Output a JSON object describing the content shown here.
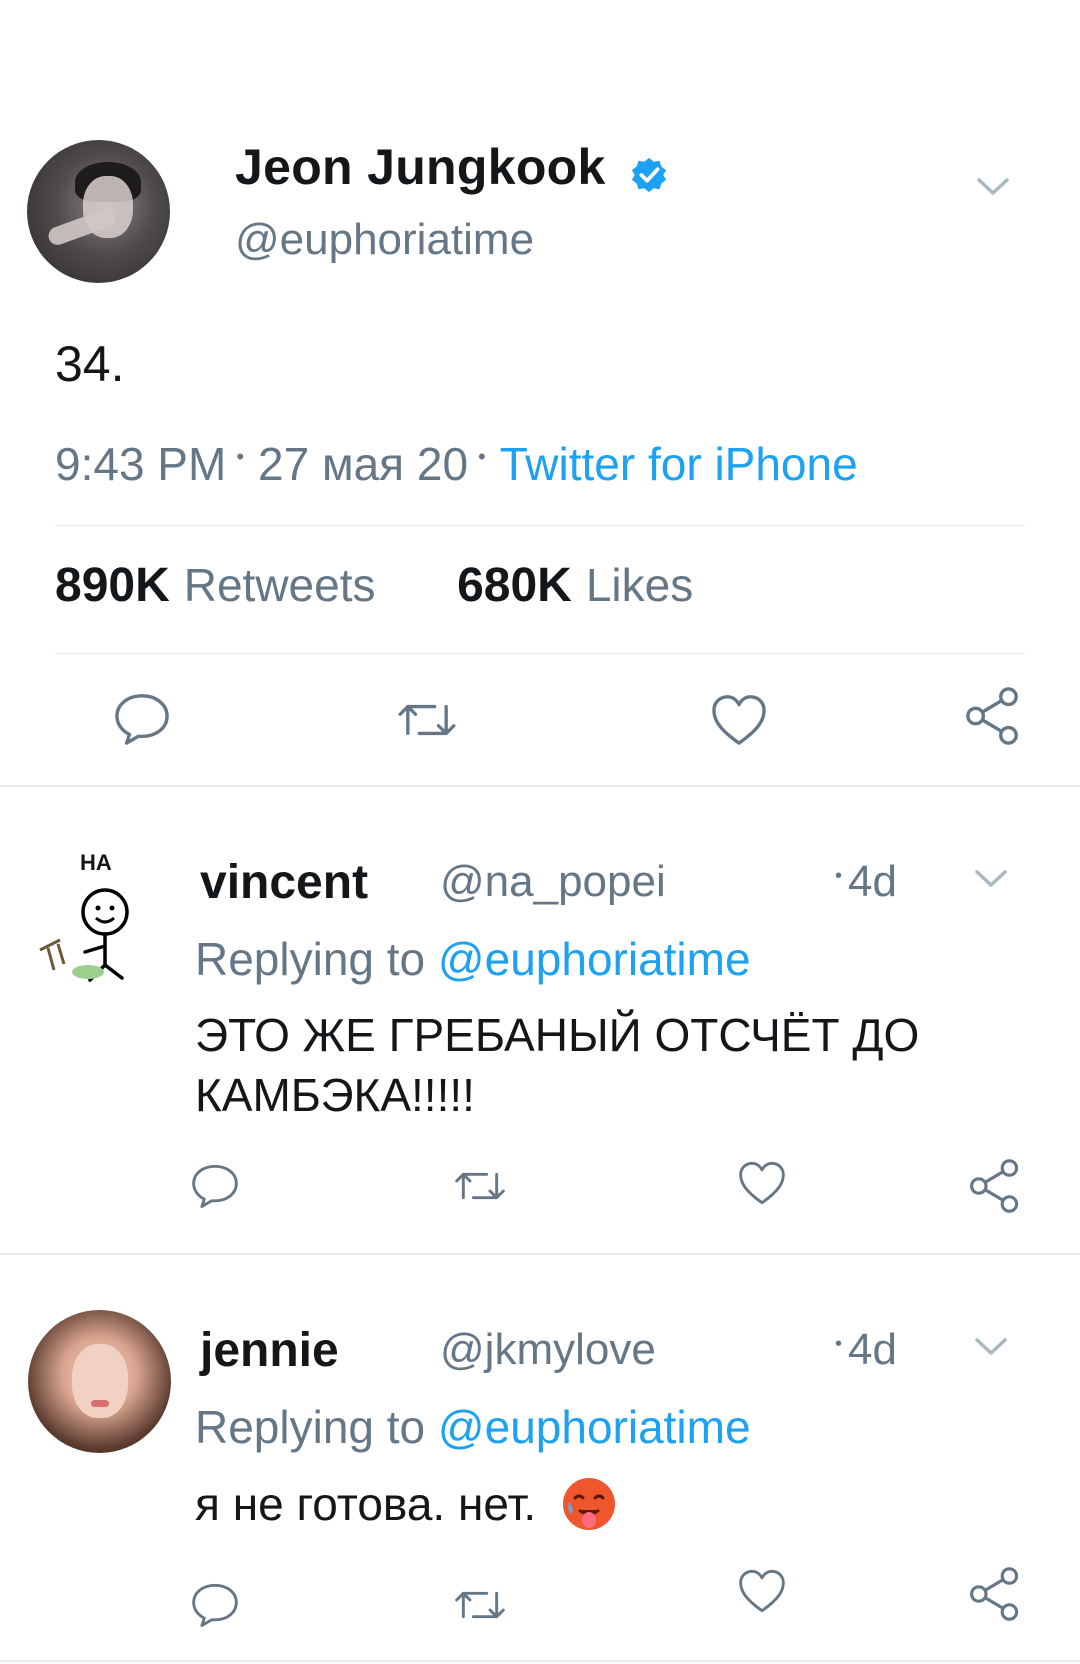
{
  "main_tweet": {
    "author_name": "Jeon Jungkook",
    "author_handle": "@euphoriatime",
    "text": "34.",
    "time": "9:43 PM",
    "date": "27 мая 20",
    "source": "Twitter for iPhone",
    "retweets_count": "890K",
    "retweets_label": "Retweets",
    "likes_count": "680K",
    "likes_label": "Likes"
  },
  "replies": [
    {
      "avatar_text": "НА",
      "name": "vincent",
      "handle": "@na_popei",
      "time": "4d",
      "replying_prefix": "Replying to",
      "replying_handle": "@euphoriatime",
      "text_line1": "ЭТО ЖЕ ГРЕБАНЫЙ ОТСЧЁТ ДО",
      "text_line2": "КАМБЭКА!!!!!"
    },
    {
      "name": "jennie",
      "handle": "@jkmylove",
      "time": "4d",
      "replying_prefix": "Replying to",
      "replying_handle": "@euphoriatime",
      "text": "я не готова. нет."
    }
  ],
  "colors": {
    "accent": "#1da1f2",
    "text": "#14171a",
    "secondary": "#657786",
    "divider": "#e1e8ed"
  },
  "icons": [
    "verified-badge-icon",
    "chevron-down-icon",
    "reply-icon",
    "retweet-icon",
    "like-icon",
    "share-icon",
    "hot-face-emoji-icon"
  ]
}
